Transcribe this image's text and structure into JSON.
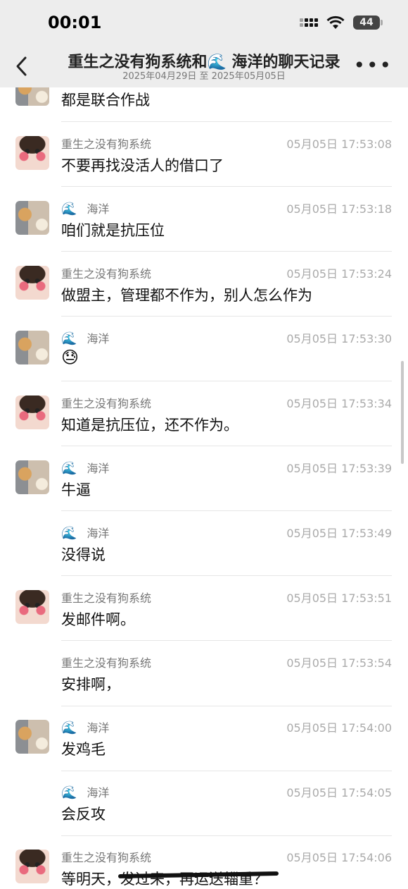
{
  "status_bar": {
    "time": "00:01",
    "battery": "44"
  },
  "header": {
    "title": "重生之没有狗系统和🌊 海洋的聊天记录",
    "subtitle": "2025年04月29日 至 2025年05月05日",
    "more": "•••"
  },
  "top_partial_text": "都是联合作战",
  "messages": [
    {
      "sender": "重生之没有狗系统",
      "time": "05月05日 17:53:08",
      "text": "不要再找没活人的借口了"
    },
    {
      "sender_emoji": "🌊",
      "sender": "海洋",
      "time": "05月05日 17:53:18",
      "text": "咱们就是抗压位"
    },
    {
      "sender": "重生之没有狗系统",
      "time": "05月05日 17:53:24",
      "text": "做盟主，管理都不作为，别人怎么作为"
    },
    {
      "sender_emoji": "🌊",
      "sender": "海洋",
      "time": "05月05日 17:53:30",
      "text": "😓"
    },
    {
      "sender": "重生之没有狗系统",
      "time": "05月05日 17:53:34",
      "text": "知道是抗压位，还不作为。"
    },
    {
      "sender_emoji": "🌊",
      "sender": "海洋",
      "time": "05月05日 17:53:39",
      "text": "牛逼"
    },
    {
      "sender_emoji": "🌊",
      "sender": "海洋",
      "time": "05月05日 17:53:49",
      "text": "没得说"
    },
    {
      "sender": "重生之没有狗系统",
      "time": "05月05日 17:53:51",
      "text": "发邮件啊。"
    },
    {
      "sender": "重生之没有狗系统",
      "time": "05月05日 17:53:54",
      "text": "安排啊，"
    },
    {
      "sender_emoji": "🌊",
      "sender": "海洋",
      "time": "05月05日 17:54:00",
      "text": "发鸡毛"
    },
    {
      "sender_emoji": "🌊",
      "sender": "海洋",
      "time": "05月05日 17:54:05",
      "text": "会反攻"
    },
    {
      "sender": "重生之没有狗系统",
      "time": "05月05日 17:54:06",
      "text": "等明天，发过来，再运送辎重？"
    }
  ]
}
